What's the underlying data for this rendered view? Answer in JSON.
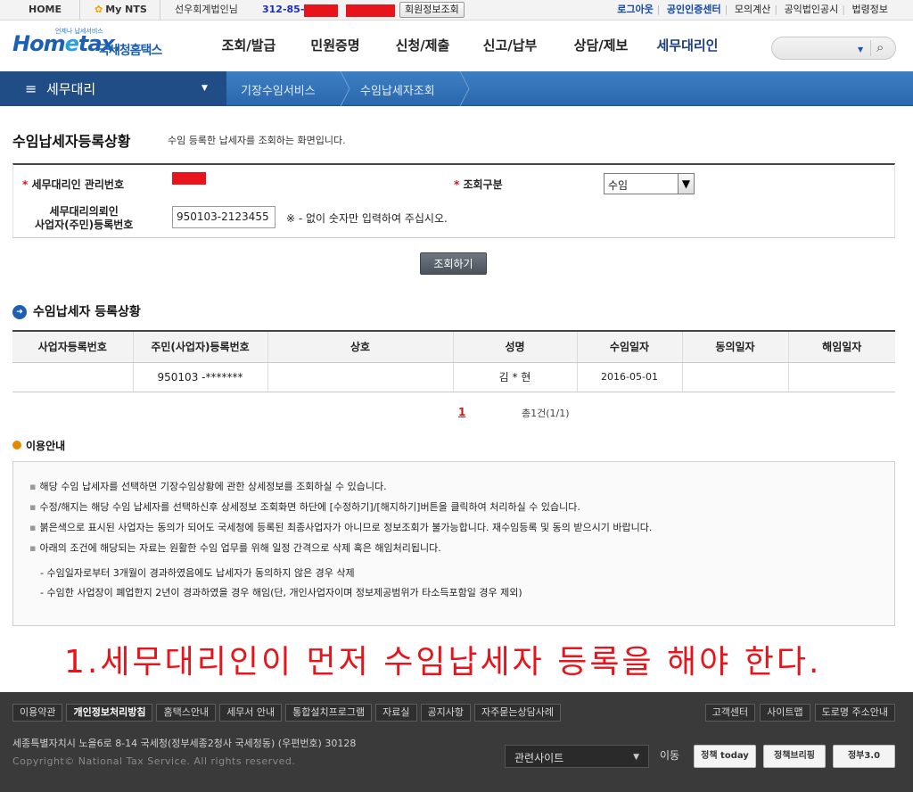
{
  "util": {
    "home": "HOME",
    "mynts": "My NTS",
    "greeting": "선우회계법인님",
    "bizno_prefix": "312-85-",
    "member_info_btn": "회원정보조회",
    "links": [
      "로그아웃",
      "공인인증센터",
      "모의계산",
      "공익법인공시",
      "법령정보"
    ]
  },
  "header": {
    "logo_small": "언제나 납세서비스",
    "logo_main_a": "Hom",
    "logo_main_e": "e",
    "logo_main_b": "tax.",
    "logo_kr": "국세청홈택스",
    "menu": [
      "조회/발급",
      "민원증명",
      "신청/제출",
      "신고/납부",
      "상담/제보",
      "세무대리인"
    ]
  },
  "navbar": {
    "section": "세무대리",
    "crumbs": [
      "기장수임서비스",
      "수임납세자조회"
    ]
  },
  "page": {
    "title": "수임납세자등록상황",
    "desc": "수임 등록한 납세자를 조회하는 화면입니다."
  },
  "form": {
    "mgmt_no_label": "세무대리인 관리번호",
    "query_type_label": "조회구분",
    "query_type_value": "수임",
    "id_label_1": "세무대리의뢰인",
    "id_label_2": "사업자(주민)등록번호",
    "id_value": "950103-2123455",
    "hint": "※ - 없이 숫자만 입력하여 주십시오.",
    "query_button": "조회하기"
  },
  "result": {
    "title": "수임납세자 등록상황",
    "columns": [
      "사업자등록번호",
      "주민(사업자)등록번호",
      "상호",
      "성명",
      "수임일자",
      "동의일자",
      "해임일자"
    ],
    "rows": [
      [
        "",
        "950103 -*******",
        "",
        "김 * 현",
        "2016-05-01",
        "",
        ""
      ]
    ],
    "page": "1",
    "total": "총1건(1/1)"
  },
  "guide": {
    "title": "이용안내",
    "bullets": [
      "해당 수임 납세자를 선택하면 기장수임상황에 관한 상세정보를 조회하실 수 있습니다.",
      "수정/해지는 해당 수임 납세자를 선택하신후 상세정보 조회화면 하단에 [수정하기]/[해지하기]버튼을 클릭하여 처리하실 수 있습니다.",
      "붉은색으로 표시된 사업자는 동의가 되어도 국세청에 등록된 최종사업자가 아니므로 정보조회가 불가능합니다. 재수임등록 및 동의 받으시기 바랍니다.",
      "아래의 조건에 해당되는 자료는 원활한 수임 업무를 위해 일정 간격으로 삭제 혹은 해임처리됩니다."
    ],
    "subitems": [
      "- 수임일자로부터 3개월이 경과하였음에도 납세자가 동의하지 않은 경우 삭제",
      "- 수임한 사업장이 폐업한지 2년이 경과하였을 경우 해임(단, 개인사업자이며 정보제공범위가 타소득포함일 경우 제외)"
    ]
  },
  "annotation": "1.세무대리인이 먼저 수임납세자 등록을 해야 한다.",
  "footer": {
    "links": [
      "이용약관",
      "개인정보처리방침",
      "홈택스안내",
      "세무서 안내",
      "통합설치프로그램",
      "자료실",
      "공지사항",
      "자주묻는상담사례"
    ],
    "right_links": [
      "고객센터",
      "사이트맵",
      "도로명 주소안내"
    ],
    "address": "세종특별자치시 노을6로 8-14 국세청(정부세종2청사 국세청동) (우편번호) 30128",
    "copyright": "Copyright© National Tax Service. All rights reserved.",
    "related_site": "관련사이트",
    "move": "이동",
    "badges": [
      "정책 today",
      "정책브리핑",
      "정부3.0"
    ]
  },
  "colors": {
    "accent_blue": "#2b68ad",
    "redaction": "#e8141c",
    "footer_bg": "#3a3a3a"
  }
}
